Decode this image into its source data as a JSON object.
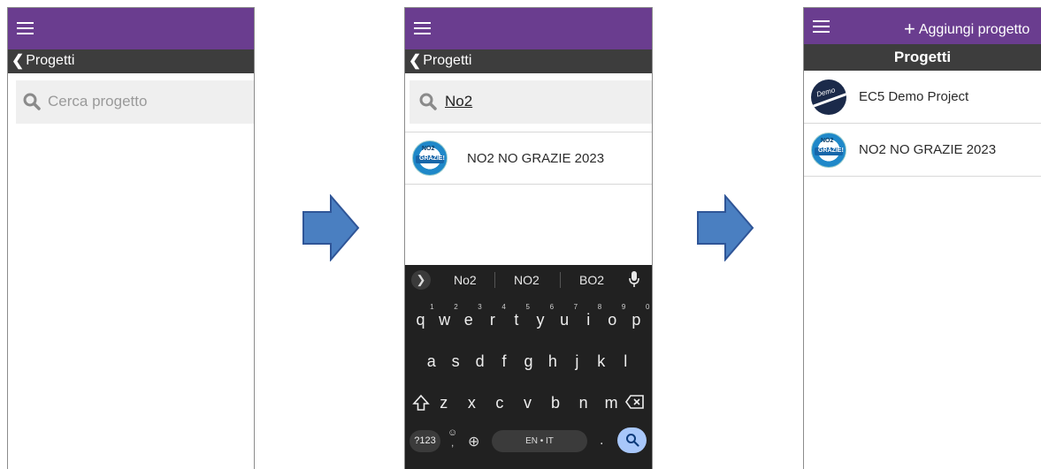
{
  "screen1": {
    "back_label": "Progetti",
    "search_placeholder": "Cerca progetto"
  },
  "screen2": {
    "back_label": "Progetti",
    "search_value": "No2",
    "result": {
      "name": "NO2 NO GRAZIE 2023",
      "logo_line1": "NO2",
      "logo_line2": "GRAZIE!"
    },
    "keyboard": {
      "suggestions": [
        "No2",
        "NO2",
        "BO2"
      ],
      "row1": [
        "q",
        "w",
        "e",
        "r",
        "t",
        "y",
        "u",
        "i",
        "o",
        "p"
      ],
      "row1_hints": [
        "1",
        "2",
        "3",
        "4",
        "5",
        "6",
        "7",
        "8",
        "9",
        "0"
      ],
      "row2": [
        "a",
        "s",
        "d",
        "f",
        "g",
        "h",
        "j",
        "k",
        "l"
      ],
      "row3": [
        "z",
        "x",
        "c",
        "v",
        "b",
        "n",
        "m"
      ],
      "symbols_key": "?123",
      "space_label": "EN • IT",
      "period": "."
    }
  },
  "screen3": {
    "add_label": "Aggiungi progetto",
    "title": "Progetti",
    "projects": [
      {
        "name": "EC5 Demo Project",
        "logo_text": "Demo"
      },
      {
        "name": "NO2 NO GRAZIE 2023",
        "logo_line1": "NO2",
        "logo_line2": "GRAZIE!"
      }
    ]
  },
  "colors": {
    "header_purple": "#6a3d8f",
    "subbar_dark": "#3d3d3d",
    "arrow_blue": "#4a7fc1",
    "keyboard_bg": "#212121"
  }
}
